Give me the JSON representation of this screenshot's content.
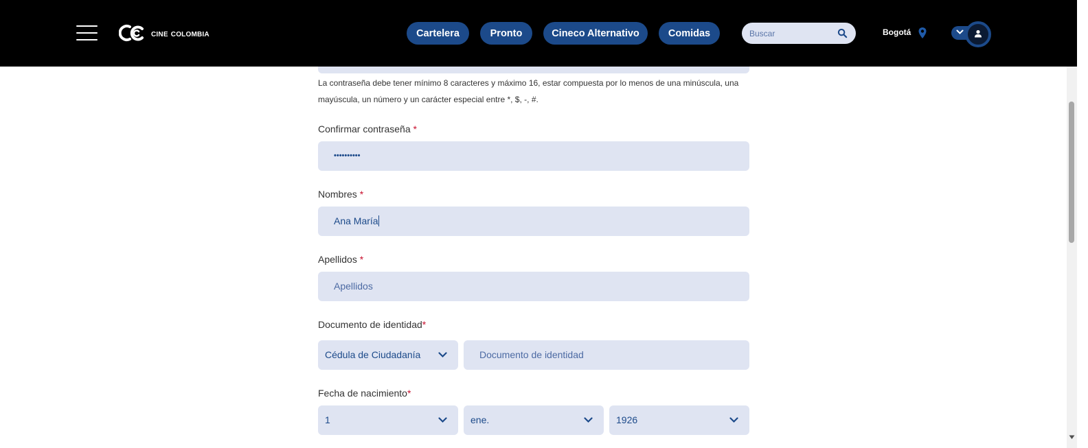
{
  "header": {
    "logo_text": "Cine Colombia",
    "nav": [
      "Cartelera",
      "Pronto",
      "Cineco Alternativo",
      "Comidas"
    ],
    "search_placeholder": "Buscar",
    "city": "Bogotá",
    "colors": {
      "background": "#000000",
      "pill": "#1c4a8a",
      "search_bg": "#dfe4f2"
    }
  },
  "form": {
    "password_hint": "La contraseña debe tener mínimo 8 caracteres y máximo 16, estar compuesta por lo menos de una minúscula, una mayúscula, un número y un carácter especial entre *, $, -, #.",
    "confirm_password": {
      "label": "Confirmar contraseña",
      "required_mark": "*",
      "value": "••••••••••"
    },
    "first_names": {
      "label": "Nombres",
      "required_mark": "*",
      "value": "Ana María"
    },
    "last_names": {
      "label": "Apellidos",
      "required_mark": "*",
      "placeholder": "Apellidos"
    },
    "identity": {
      "label": "Documento de identidad",
      "required_mark": "*",
      "doc_type": "Cédula de Ciudadanía",
      "number_placeholder": "Documento de identidad"
    },
    "birth_date": {
      "label": "Fecha de nacimiento",
      "required_mark": "*",
      "day": "1",
      "month": "ene.",
      "year": "1926"
    },
    "colors": {
      "field_bg": "#dfe4f2",
      "field_text": "#1c4a8a",
      "required": "#c8102e"
    }
  }
}
